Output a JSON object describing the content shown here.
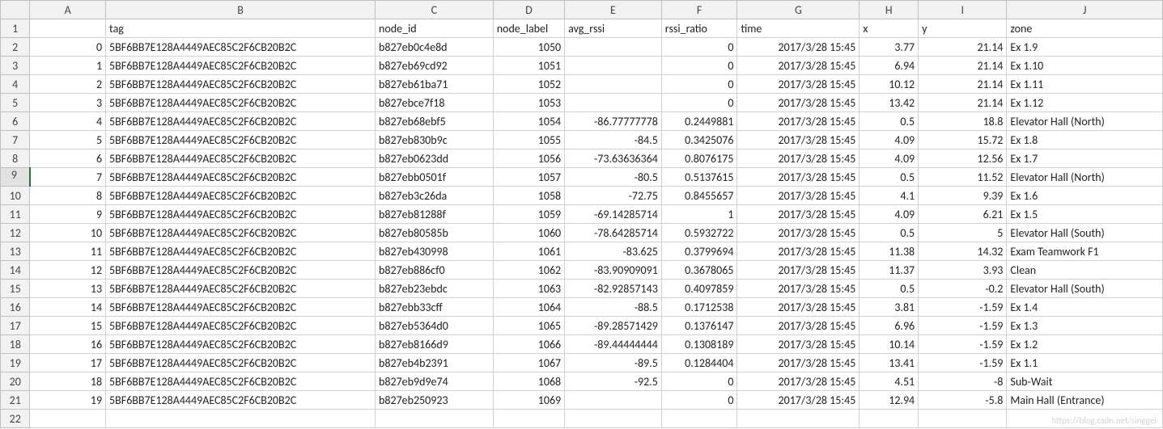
{
  "watermark": "https://blog.csdn.net/singgeI",
  "columns": [
    "A",
    "B",
    "C",
    "D",
    "E",
    "F",
    "G",
    "H",
    "I",
    "J"
  ],
  "headers_row": {
    "A": "",
    "B": "tag",
    "C": "node_id",
    "D": "node_label",
    "E": "avg_rssi",
    "F": "rssi_ratio",
    "G": "time",
    "H": "x",
    "I": "y",
    "J": "zone"
  },
  "col_align": {
    "A": "num",
    "B": "txt",
    "C": "txt",
    "D": "num",
    "E": "num",
    "F": "num",
    "G": "num",
    "H": "num",
    "I": "num",
    "J": "txt"
  },
  "rows": [
    {
      "A": "0",
      "B": "5BF6BB7E128A4449AEC85C2F6CB20B2C",
      "C": "b827eb0c4e8d",
      "D": "1050",
      "E": "",
      "F": "0",
      "G": "2017/3/28 15:45",
      "H": "3.77",
      "I": "21.14",
      "J": "Ex 1.9"
    },
    {
      "A": "1",
      "B": "5BF6BB7E128A4449AEC85C2F6CB20B2C",
      "C": "b827eb69cd92",
      "D": "1051",
      "E": "",
      "F": "0",
      "G": "2017/3/28 15:45",
      "H": "6.94",
      "I": "21.14",
      "J": "Ex 1.10"
    },
    {
      "A": "2",
      "B": "5BF6BB7E128A4449AEC85C2F6CB20B2C",
      "C": "b827eb61ba71",
      "D": "1052",
      "E": "",
      "F": "0",
      "G": "2017/3/28 15:45",
      "H": "10.12",
      "I": "21.14",
      "J": "Ex 1.11"
    },
    {
      "A": "3",
      "B": "5BF6BB7E128A4449AEC85C2F6CB20B2C",
      "C": "b827ebce7f18",
      "D": "1053",
      "E": "",
      "F": "0",
      "G": "2017/3/28 15:45",
      "H": "13.42",
      "I": "21.14",
      "J": "Ex 1.12"
    },
    {
      "A": "4",
      "B": "5BF6BB7E128A4449AEC85C2F6CB20B2C",
      "C": "b827eb68ebf5",
      "D": "1054",
      "E": "-86.77777778",
      "F": "0.2449881",
      "G": "2017/3/28 15:45",
      "H": "0.5",
      "I": "18.8",
      "J": "Elevator Hall (North)"
    },
    {
      "A": "5",
      "B": "5BF6BB7E128A4449AEC85C2F6CB20B2C",
      "C": "b827eb830b9c",
      "D": "1055",
      "E": "-84.5",
      "F": "0.3425076",
      "G": "2017/3/28 15:45",
      "H": "4.09",
      "I": "15.72",
      "J": "Ex 1.8"
    },
    {
      "A": "6",
      "B": "5BF6BB7E128A4449AEC85C2F6CB20B2C",
      "C": "b827eb0623dd",
      "D": "1056",
      "E": "-73.63636364",
      "F": "0.8076175",
      "G": "2017/3/28 15:45",
      "H": "4.09",
      "I": "12.56",
      "J": "Ex 1.7"
    },
    {
      "A": "7",
      "B": "5BF6BB7E128A4449AEC85C2F6CB20B2C",
      "C": "b827ebb0501f",
      "D": "1057",
      "E": "-80.5",
      "F": "0.5137615",
      "G": "2017/3/28 15:45",
      "H": "0.5",
      "I": "11.52",
      "J": "Elevator Hall (North)"
    },
    {
      "A": "8",
      "B": "5BF6BB7E128A4449AEC85C2F6CB20B2C",
      "C": "b827eb3c26da",
      "D": "1058",
      "E": "-72.75",
      "F": "0.8455657",
      "G": "2017/3/28 15:45",
      "H": "4.1",
      "I": "9.39",
      "J": "Ex 1.6"
    },
    {
      "A": "9",
      "B": "5BF6BB7E128A4449AEC85C2F6CB20B2C",
      "C": "b827eb81288f",
      "D": "1059",
      "E": "-69.14285714",
      "F": "1",
      "G": "2017/3/28 15:45",
      "H": "4.09",
      "I": "6.21",
      "J": "Ex 1.5"
    },
    {
      "A": "10",
      "B": "5BF6BB7E128A4449AEC85C2F6CB20B2C",
      "C": "b827eb80585b",
      "D": "1060",
      "E": "-78.64285714",
      "F": "0.5932722",
      "G": "2017/3/28 15:45",
      "H": "0.5",
      "I": "5",
      "J": "Elevator Hall (South)"
    },
    {
      "A": "11",
      "B": "5BF6BB7E128A4449AEC85C2F6CB20B2C",
      "C": "b827eb430998",
      "D": "1061",
      "E": "-83.625",
      "F": "0.3799694",
      "G": "2017/3/28 15:45",
      "H": "11.38",
      "I": "14.32",
      "J": "Exam Teamwork F1"
    },
    {
      "A": "12",
      "B": "5BF6BB7E128A4449AEC85C2F6CB20B2C",
      "C": "b827eb886cf0",
      "D": "1062",
      "E": "-83.90909091",
      "F": "0.3678065",
      "G": "2017/3/28 15:45",
      "H": "11.37",
      "I": "3.93",
      "J": "Clean"
    },
    {
      "A": "13",
      "B": "5BF6BB7E128A4449AEC85C2F6CB20B2C",
      "C": "b827eb23ebdc",
      "D": "1063",
      "E": "-82.92857143",
      "F": "0.4097859",
      "G": "2017/3/28 15:45",
      "H": "0.5",
      "I": "-0.2",
      "J": "Elevator Hall (South)"
    },
    {
      "A": "14",
      "B": "5BF6BB7E128A4449AEC85C2F6CB20B2C",
      "C": "b827ebb33cff",
      "D": "1064",
      "E": "-88.5",
      "F": "0.1712538",
      "G": "2017/3/28 15:45",
      "H": "3.81",
      "I": "-1.59",
      "J": "Ex 1.4"
    },
    {
      "A": "15",
      "B": "5BF6BB7E128A4449AEC85C2F6CB20B2C",
      "C": "b827eb5364d0",
      "D": "1065",
      "E": "-89.28571429",
      "F": "0.1376147",
      "G": "2017/3/28 15:45",
      "H": "6.96",
      "I": "-1.59",
      "J": "Ex 1.3"
    },
    {
      "A": "16",
      "B": "5BF6BB7E128A4449AEC85C2F6CB20B2C",
      "C": "b827eb8166d9",
      "D": "1066",
      "E": "-89.44444444",
      "F": "0.1308189",
      "G": "2017/3/28 15:45",
      "H": "10.14",
      "I": "-1.59",
      "J": "Ex 1.2"
    },
    {
      "A": "17",
      "B": "5BF6BB7E128A4449AEC85C2F6CB20B2C",
      "C": "b827eb4b2391",
      "D": "1067",
      "E": "-89.5",
      "F": "0.1284404",
      "G": "2017/3/28 15:45",
      "H": "13.41",
      "I": "-1.59",
      "J": "Ex 1.1"
    },
    {
      "A": "18",
      "B": "5BF6BB7E128A4449AEC85C2F6CB20B2C",
      "C": "b827eb9d9e74",
      "D": "1068",
      "E": "-92.5",
      "F": "0",
      "G": "2017/3/28 15:45",
      "H": "4.51",
      "I": "-8",
      "J": "Sub-Wait"
    },
    {
      "A": "19",
      "B": "5BF6BB7E128A4449AEC85C2F6CB20B2C",
      "C": "b827eb250923",
      "D": "1069",
      "E": "",
      "F": "0",
      "G": "2017/3/28 15:45",
      "H": "12.94",
      "I": "-5.8",
      "J": "Main Hall (Entrance)"
    }
  ],
  "row_count_total": 22,
  "selected_row_header": 9
}
